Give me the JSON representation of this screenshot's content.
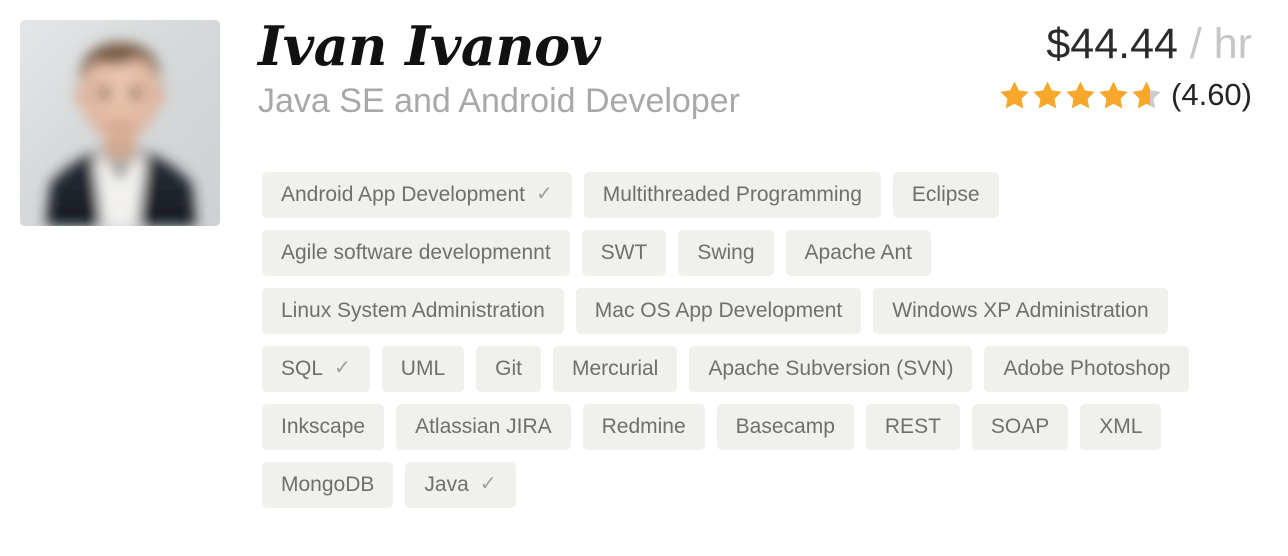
{
  "profile": {
    "name": "Ivan Ivanov",
    "title": "Java SE and Android Developer",
    "avatar_icon": "person-photo"
  },
  "rate": {
    "amount": "$44.44",
    "unit": "/ hr"
  },
  "rating": {
    "value": "(4.60)",
    "score": 4.6,
    "max": 5,
    "star_icon": "star-icon",
    "star_filled_color": "#f7a82b",
    "star_empty_color": "#cccccc"
  },
  "skills": [
    {
      "label": "Android App Development",
      "verified": true,
      "check_icon": "check-icon"
    },
    {
      "label": "Multithreaded Programming",
      "verified": false,
      "check_icon": "check-icon"
    },
    {
      "label": "Eclipse",
      "verified": false,
      "check_icon": "check-icon"
    },
    {
      "label": "Agile software developmennt",
      "verified": false,
      "check_icon": "check-icon"
    },
    {
      "label": "SWT",
      "verified": false,
      "check_icon": "check-icon"
    },
    {
      "label": "Swing",
      "verified": false,
      "check_icon": "check-icon"
    },
    {
      "label": "Apache Ant",
      "verified": false,
      "check_icon": "check-icon"
    },
    {
      "label": "Linux System Administration",
      "verified": false,
      "check_icon": "check-icon"
    },
    {
      "label": "Mac OS App Development",
      "verified": false,
      "check_icon": "check-icon"
    },
    {
      "label": "Windows XP Administration",
      "verified": false,
      "check_icon": "check-icon"
    },
    {
      "label": "SQL",
      "verified": true,
      "check_icon": "check-icon"
    },
    {
      "label": "UML",
      "verified": false,
      "check_icon": "check-icon"
    },
    {
      "label": "Git",
      "verified": false,
      "check_icon": "check-icon"
    },
    {
      "label": "Mercurial",
      "verified": false,
      "check_icon": "check-icon"
    },
    {
      "label": "Apache Subversion (SVN)",
      "verified": false,
      "check_icon": "check-icon"
    },
    {
      "label": "Adobe Photoshop",
      "verified": false,
      "check_icon": "check-icon"
    },
    {
      "label": "Inkscape",
      "verified": false,
      "check_icon": "check-icon"
    },
    {
      "label": "Atlassian JIRA",
      "verified": false,
      "check_icon": "check-icon"
    },
    {
      "label": "Redmine",
      "verified": false,
      "check_icon": "check-icon"
    },
    {
      "label": "Basecamp",
      "verified": false,
      "check_icon": "check-icon"
    },
    {
      "label": "REST",
      "verified": false,
      "check_icon": "check-icon"
    },
    {
      "label": "SOAP",
      "verified": false,
      "check_icon": "check-icon"
    },
    {
      "label": "XML",
      "verified": false,
      "check_icon": "check-icon"
    },
    {
      "label": "MongoDB",
      "verified": false,
      "check_icon": "check-icon"
    },
    {
      "label": "Java",
      "verified": true,
      "check_icon": "check-icon"
    }
  ],
  "icons": {
    "check_glyph": "✓"
  },
  "colors": {
    "tag_background": "#f0f0ec",
    "tag_text": "#6f6f6f",
    "name_text": "#111111",
    "title_text": "#a8a8a8",
    "rate_amount_text": "#2b2b2b",
    "rate_unit_text": "#c6c6c6",
    "star_filled": "#f7a82b",
    "star_empty": "#cccccc",
    "page_background": "#ffffff"
  }
}
